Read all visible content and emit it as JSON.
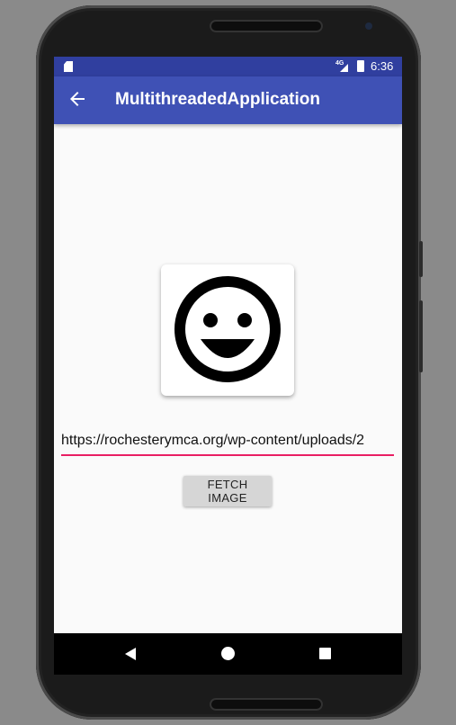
{
  "status_bar": {
    "time": "6:36",
    "network": "4G"
  },
  "app_bar": {
    "title": "MultithreadedApplication",
    "back_icon": "arrow-back-icon"
  },
  "image_view": {
    "icon": "smiley-face-icon"
  },
  "url_field": {
    "value": "https://rochesterymca.org/wp-content/uploads/2"
  },
  "fetch_button": {
    "label": "FETCH IMAGE"
  },
  "nav_bar": {
    "back_icon": "nav-back-icon",
    "home_icon": "nav-home-icon",
    "recents_icon": "nav-recents-icon"
  },
  "colors": {
    "status_bar": "#303f9f",
    "app_bar": "#3f51b5",
    "accent": "#e91e63"
  }
}
